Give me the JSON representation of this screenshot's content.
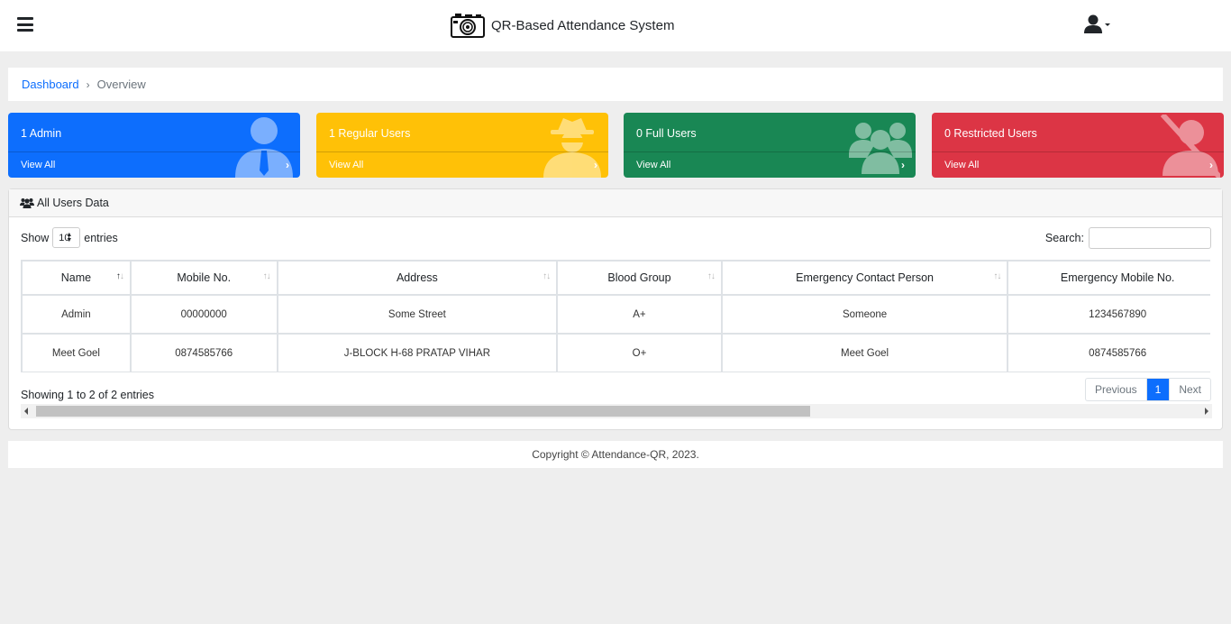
{
  "header": {
    "title": "QR-Based Attendance System",
    "menu_icon": "hamburger-icon",
    "logo_icon": "camera-icon",
    "user_icon": "user-icon"
  },
  "breadcrumb": {
    "home": "Dashboard",
    "current": "Overview"
  },
  "cards": [
    {
      "title": "1 Admin",
      "link": "View All",
      "color": "#0d6efd",
      "icon": "user-tie-icon"
    },
    {
      "title": "1 Regular Users",
      "link": "View All",
      "color": "#ffc107",
      "icon": "user-secret-icon"
    },
    {
      "title": "0 Full Users",
      "link": "View All",
      "color": "#198754",
      "icon": "users-icon"
    },
    {
      "title": "0 Restricted Users",
      "link": "View All",
      "color": "#dc3545",
      "icon": "user-slash-icon"
    }
  ],
  "panel": {
    "title": "All Users Data",
    "show_label": "Show",
    "entries_label": "entries",
    "page_length": "10",
    "search_label": "Search:",
    "search_value": ""
  },
  "table": {
    "columns": [
      "Name",
      "Mobile No.",
      "Address",
      "Blood Group",
      "Emergency Contact Person",
      "Emergency Mobile No."
    ],
    "rows": [
      [
        "Admin",
        "00000000",
        "Some Street",
        "A+",
        "Someone",
        "1234567890"
      ],
      [
        "Meet Goel",
        "0874585766",
        "J-BLOCK H-68 PRATAP VIHAR",
        "O+",
        "Meet Goel",
        "0874585766"
      ]
    ]
  },
  "pagination": {
    "info": "Showing 1 to 2 of 2 entries",
    "previous": "Previous",
    "current": "1",
    "next": "Next"
  },
  "footer": {
    "text": "Copyright © Attendance-QR, 2023."
  }
}
